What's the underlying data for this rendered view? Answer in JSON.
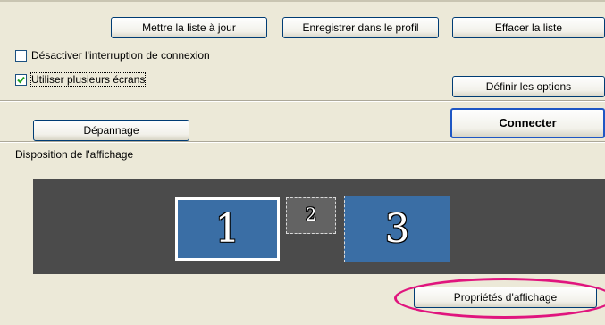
{
  "buttons": {
    "update_list": "Mettre la liste à jour",
    "save_profile": "Enregistrer dans le profil",
    "clear_list": "Effacer la liste",
    "define_options": "Définir les options",
    "troubleshoot": "Dépannage",
    "connect": "Connecter",
    "display_properties": "Propriétés d'affichage"
  },
  "options": {
    "disable_interrupt": {
      "label": "Désactiver l'interruption de connexion",
      "checked": false
    },
    "multiple_screens": {
      "label": "Utiliser plusieurs écrans",
      "checked": true
    }
  },
  "display_layout": {
    "title": "Disposition de l'affichage",
    "monitors": [
      {
        "label": "1",
        "state": "selected"
      },
      {
        "label": "2",
        "state": "inactive"
      },
      {
        "label": "3",
        "state": "active"
      }
    ]
  },
  "colors": {
    "dialog_bg": "#ece9d8",
    "panel_bg": "#4b4b4b",
    "monitor_active": "#3a6ea5",
    "monitor_inactive": "#636363",
    "highlight_ellipse": "#e0157e",
    "button_border": "#003c74",
    "default_button_border": "#1f57c4"
  }
}
